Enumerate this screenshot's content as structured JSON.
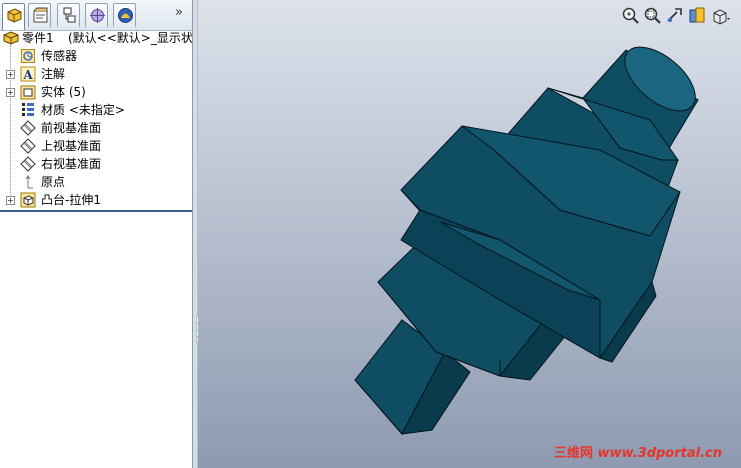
{
  "panel": {
    "tabs": [
      {
        "name": "feature-manager-tab",
        "icon": "feature-manager-icon",
        "active": true
      },
      {
        "name": "property-manager-tab",
        "icon": "property-manager-icon",
        "active": false
      },
      {
        "name": "configuration-manager-tab",
        "icon": "configuration-manager-icon",
        "active": false
      },
      {
        "name": "dimxpert-manager-tab",
        "icon": "dimxpert-icon",
        "active": false
      },
      {
        "name": "display-manager-tab",
        "icon": "display-manager-icon",
        "active": false
      }
    ],
    "more_label": "»"
  },
  "tree": {
    "root": {
      "label": "零件1",
      "config": "(默认<<默认>_显示状态"
    },
    "items": [
      {
        "label": "传感器",
        "icon": "sensor-icon",
        "expandable": false
      },
      {
        "label": "注解",
        "icon": "annotation-icon",
        "expandable": true
      },
      {
        "label": "实体 (5)",
        "icon": "solid-bodies-icon",
        "expandable": true
      },
      {
        "label": "材质 <未指定>",
        "icon": "material-icon",
        "expandable": false
      },
      {
        "label": "前视基准面",
        "icon": "plane-icon",
        "expandable": false
      },
      {
        "label": "上视基准面",
        "icon": "plane-icon",
        "expandable": false
      },
      {
        "label": "右视基准面",
        "icon": "plane-icon",
        "expandable": false
      },
      {
        "label": "原点",
        "icon": "origin-icon",
        "expandable": false
      },
      {
        "label": "凸台-拉伸1",
        "icon": "extrude-icon",
        "expandable": true
      }
    ]
  },
  "view_toolbar": [
    "zoom-to-fit-icon",
    "zoom-to-area-icon",
    "previous-view-icon",
    "section-view-icon",
    "view-orientation-icon"
  ],
  "colors": {
    "model_fill": "#0f4d63",
    "model_dark": "#0a3b4d",
    "model_light": "#1a6680",
    "model_edge": "#02151d",
    "watermark": "#e8342a"
  },
  "watermark": {
    "brand": "三维网",
    "site": "www.3dportal.cn"
  }
}
